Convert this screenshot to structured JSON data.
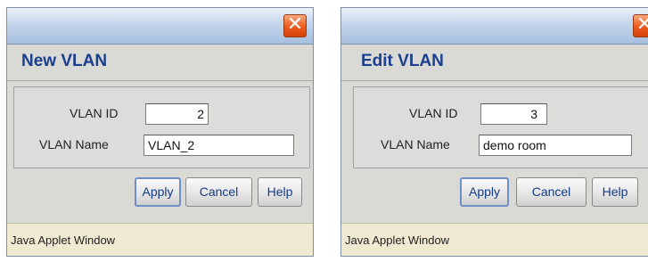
{
  "dialogs": {
    "new_vlan": {
      "title": "New VLAN",
      "vlan_id_label": "VLAN ID",
      "vlan_id_value": "2",
      "vlan_name_label": "VLAN Name",
      "vlan_name_value": "VLAN_2",
      "apply_label": "Apply",
      "cancel_label": "Cancel",
      "help_label": "Help",
      "status_text": "Java Applet Window",
      "close_glyph": "✕"
    },
    "edit_vlan": {
      "title": "Edit VLAN",
      "vlan_id_label": "VLAN ID",
      "vlan_id_value": "3",
      "vlan_name_label": "VLAN Name",
      "vlan_name_value": "demo room",
      "apply_label": "Apply",
      "cancel_label": "Cancel",
      "help_label": "Help",
      "status_text": "Java Applet Window",
      "close_glyph": "✕"
    }
  },
  "colors": {
    "title_text": "#1b3f8f",
    "close_button": "#ec5a1c",
    "statusbar_bg": "#f1ead2",
    "dialog_bg": "#d9d9d6"
  }
}
